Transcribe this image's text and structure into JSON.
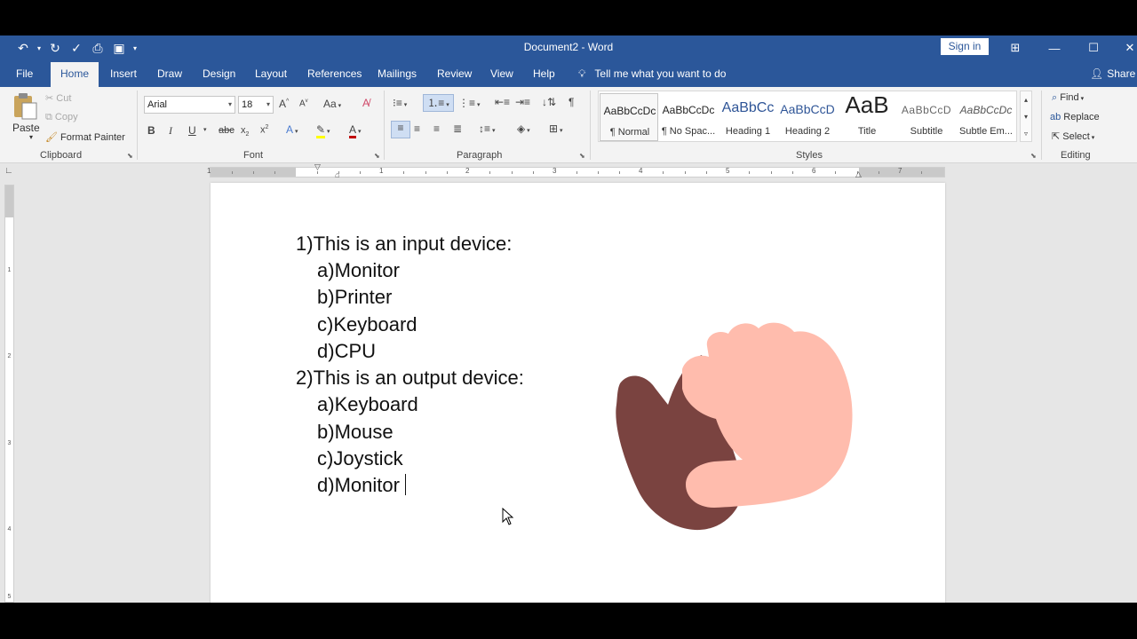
{
  "window": {
    "title": "Document2  -  Word",
    "sign_in": "Sign in"
  },
  "tabs": [
    "File",
    "Home",
    "Insert",
    "Draw",
    "Design",
    "Layout",
    "References",
    "Mailings",
    "Review",
    "View",
    "Help"
  ],
  "active_tab": "Home",
  "tell_me": "Tell me what you want to do",
  "share": "Share",
  "clipboard": {
    "paste": "Paste",
    "cut": "Cut",
    "copy": "Copy",
    "format_painter": "Format Painter",
    "label": "Clipboard"
  },
  "font": {
    "name": "Arial",
    "size": "18",
    "label": "Font"
  },
  "paragraph": {
    "label": "Paragraph"
  },
  "styles": {
    "label": "Styles",
    "items": [
      {
        "preview": "AaBbCcDc",
        "name": "¶ Normal"
      },
      {
        "preview": "AaBbCcDc",
        "name": "¶ No Spac..."
      },
      {
        "preview": "AaBbCc",
        "name": "Heading 1"
      },
      {
        "preview": "AaBbCcD",
        "name": "Heading 2"
      },
      {
        "preview": "AaB",
        "name": "Title"
      },
      {
        "preview": "AaBbCcD",
        "name": "Subtitle"
      },
      {
        "preview": "AaBbCcDc",
        "name": "Subtle Em..."
      }
    ]
  },
  "editing": {
    "find": "Find",
    "replace": "Replace",
    "select": "Select",
    "label": "Editing"
  },
  "ruler": {
    "h_numbers": [
      "1",
      "1",
      "2",
      "3",
      "4",
      "5",
      "6",
      "7"
    ],
    "v_numbers": [
      "1",
      "2",
      "3",
      "4",
      "5"
    ]
  },
  "document": {
    "lines": [
      {
        "marker": "1)",
        "text": "This is an input device:",
        "level": 0
      },
      {
        "marker": "a)",
        "text": "Monitor",
        "level": 1
      },
      {
        "marker": "b)",
        "text": "Printer",
        "level": 1
      },
      {
        "marker": "c)",
        "text": "Keyboard",
        "level": 1
      },
      {
        "marker": "d)",
        "text": "CPU",
        "level": 1
      },
      {
        "marker": "2)",
        "text": "This is an output device:",
        "level": 0
      },
      {
        "marker": "a)",
        "text": "Keyboard",
        "level": 1
      },
      {
        "marker": "b)",
        "text": "Mouse",
        "level": 1
      },
      {
        "marker": "c)",
        "text": "Joystick",
        "level": 1
      },
      {
        "marker": "d)",
        "text": "Monitor",
        "level": 1
      }
    ]
  },
  "colors": {
    "word_blue": "#2b579a",
    "hand_skin": "#ffbcad",
    "hand_dark": "#7a4340"
  }
}
